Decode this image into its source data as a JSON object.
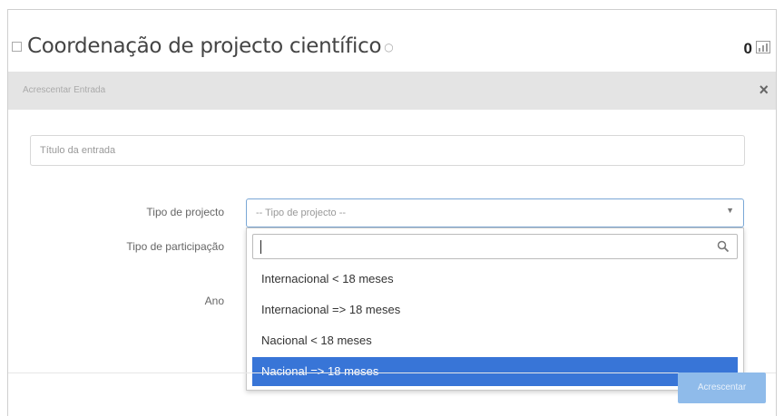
{
  "header": {
    "title": "Coordenação de projecto científico",
    "info_icon": "info-icon",
    "count": "0",
    "chart_icon": "bar-chart-icon"
  },
  "modal": {
    "title": "Acrescentar Entrada",
    "close_label": "×",
    "entry_placeholder": "Título da entrada",
    "labels": {
      "project_type": "Tipo de projecto",
      "participation_type": "Tipo de participação",
      "year": "Ano"
    },
    "select": {
      "value": "-- Tipo de projecto --",
      "arrow": "▼"
    },
    "dropdown": {
      "search_value": "",
      "search_icon": "search-icon",
      "options": [
        "Internacional < 18 meses",
        "Internacional => 18 meses",
        "Nacional < 18 meses",
        "Nacional => 18 meses"
      ],
      "highlighted_index": 3
    },
    "submit_label": "Acrescentar"
  },
  "colors": {
    "accent": "#3875d7",
    "button": "#8fbbea",
    "header_bg": "#e4e4e4"
  }
}
